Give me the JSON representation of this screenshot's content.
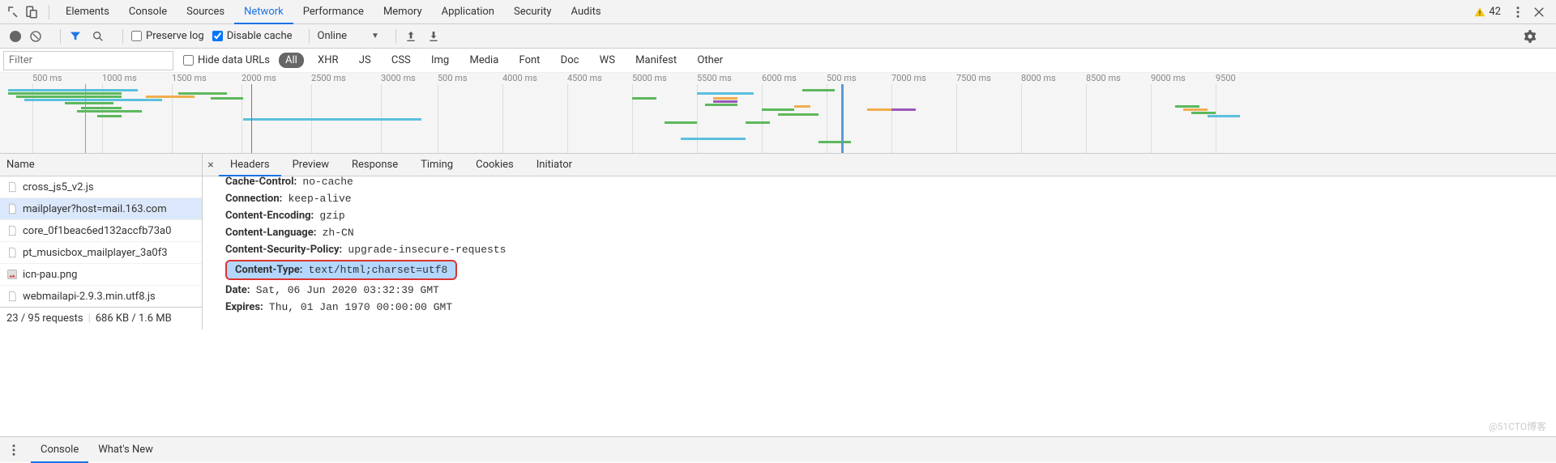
{
  "top": {
    "tabs": [
      "Elements",
      "Console",
      "Sources",
      "Network",
      "Performance",
      "Memory",
      "Application",
      "Security",
      "Audits"
    ],
    "active": 3,
    "warnings": "42"
  },
  "toolbar": {
    "preserve_log": "Preserve log",
    "disable_cache": "Disable cache",
    "throttling": "Online"
  },
  "filterbar": {
    "placeholder": "Filter",
    "hide_data_urls": "Hide data URLs",
    "types": [
      "All",
      "XHR",
      "JS",
      "CSS",
      "Img",
      "Media",
      "Font",
      "Doc",
      "WS",
      "Manifest",
      "Other"
    ]
  },
  "waterfall": {
    "left_ticks": [
      "500 ms",
      "1000 ms",
      "1500 ms",
      "2000 ms",
      "2500 ms",
      "3000 ms"
    ],
    "right_ticks": [
      "500 ms",
      "4000 ms",
      "4500 ms",
      "5000 ms",
      "5500 ms",
      "6000 ms",
      "500 ms",
      "7000 ms",
      "7500 ms",
      "8000 ms",
      "8500 ms",
      "9000 ms",
      "9500"
    ]
  },
  "names": {
    "header": "Name",
    "rows": [
      {
        "label": "cross_js5_v2.js",
        "icon": "file"
      },
      {
        "label": "mailplayer?host=mail.163.com",
        "icon": "file",
        "selected": true
      },
      {
        "label": "core_0f1beac6ed132accfb73a0",
        "icon": "file"
      },
      {
        "label": "pt_musicbox_mailplayer_3a0f3",
        "icon": "file"
      },
      {
        "label": "icn-pau.png",
        "icon": "image"
      },
      {
        "label": "webmailapi-2.9.3.min.utf8.js",
        "icon": "file"
      }
    ]
  },
  "status": {
    "requests": "23 / 95 requests",
    "transferred": "686 KB / 1.6 MB"
  },
  "detail": {
    "tabs": [
      "Headers",
      "Preview",
      "Response",
      "Timing",
      "Cookies",
      "Initiator"
    ],
    "active": 0,
    "headers": [
      {
        "k": "Cache-Control:",
        "v": "no-cache",
        "cut": true
      },
      {
        "k": "Connection:",
        "v": "keep-alive"
      },
      {
        "k": "Content-Encoding:",
        "v": "gzip"
      },
      {
        "k": "Content-Language:",
        "v": "zh-CN"
      },
      {
        "k": "Content-Security-Policy:",
        "v": "upgrade-insecure-requests"
      },
      {
        "k": "Content-Type:",
        "v": "text/html;charset=utf8",
        "hl": true
      },
      {
        "k": "Date:",
        "v": "Sat, 06 Jun 2020 03:32:39 GMT"
      },
      {
        "k": "Expires:",
        "v": "Thu, 01 Jan 1970 00:00:00 GMT"
      }
    ]
  },
  "drawer": {
    "tabs": [
      "Console",
      "What's New"
    ],
    "active": 0
  },
  "watermark": "@51CTO博客"
}
